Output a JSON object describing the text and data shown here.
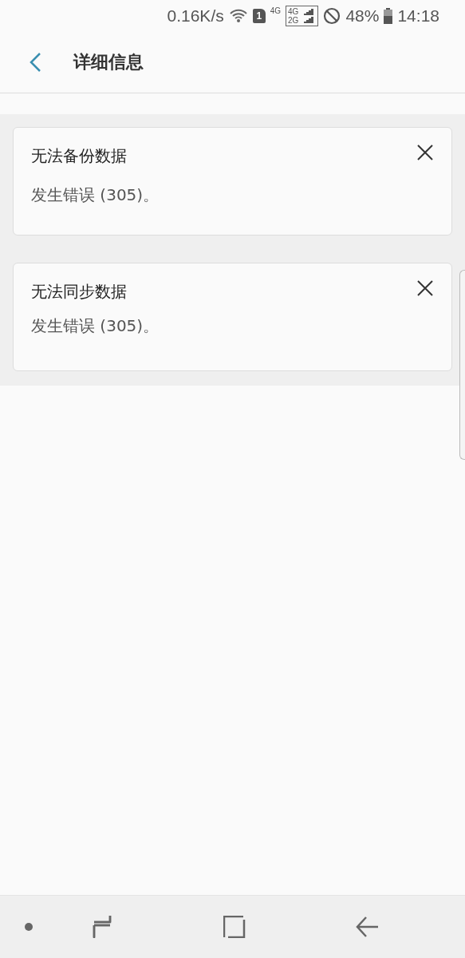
{
  "status_bar": {
    "speed": "0.16K/s",
    "sim_slot": "1",
    "network": "4G",
    "signal_labels": [
      "4G",
      "2G"
    ],
    "battery": "48%",
    "time": "14:18"
  },
  "header": {
    "title": "详细信息"
  },
  "cards": [
    {
      "title": "无法备份数据",
      "message": "发生错误 (305)。"
    },
    {
      "title": "无法同步数据",
      "message": "发生错误 (305)。"
    }
  ]
}
